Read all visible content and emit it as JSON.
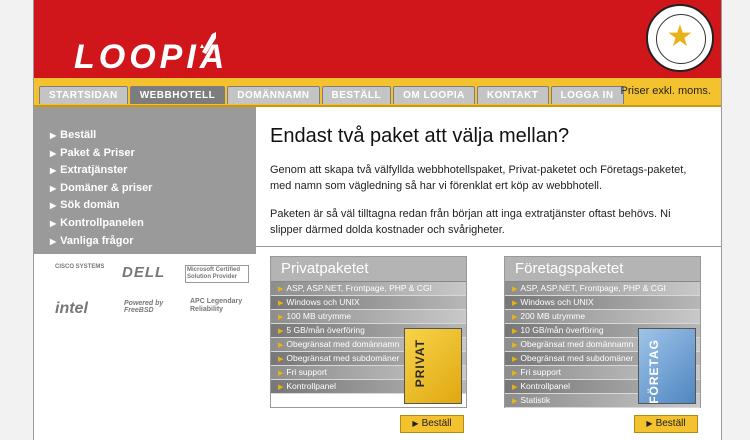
{
  "brand": {
    "logo_text": "LOOPIA",
    "seal_top": "REKOMMENDERAS AV",
    "seal_bottom": "Internetworld 2004"
  },
  "nav": {
    "tabs": [
      "STARTSIDAN",
      "WEBBHOTELL",
      "DOMÄNNAMN",
      "BESTÄLL",
      "OM LOOPIA",
      "KONTAKT",
      "LOGGA IN"
    ],
    "active_index": 1,
    "prices_note": "Priser exkl. moms."
  },
  "sidebar": {
    "items": [
      "Beställ",
      "Paket & Priser",
      "Extratjänster",
      "Domäner & priser",
      "Sök domän",
      "Kontrollpanelen",
      "Vanliga frågor"
    ]
  },
  "partners": [
    "CISCO SYSTEMS",
    "DELL",
    "Microsoft Certified Solution Provider",
    "intel",
    "Powered by FreeBSD",
    "APC Legendary Reliability"
  ],
  "main": {
    "heading": "Endast två paket att välja mellan?",
    "para1": "Genom att skapa två välfyllda webbhotellspaket, Privat-paketet och Företags-paketet, med namn som vägledning så har vi förenklat ert köp av webbhotell.",
    "para2": "Paketen är så väl tilltagna redan från början att inga extratjänster oftast behövs. Ni slipper därmed dolda kostnader och svårigheter."
  },
  "packages": [
    {
      "title": "Privatpaketet",
      "box_label": "PRIVAT",
      "features": [
        "ASP, ASP.NET, Frontpage, PHP & CGI",
        "Windows och UNIX",
        "100 MB utrymme",
        "5 GB/mån överföring",
        "Obegränsat med domännamn",
        "Obegränsat med subdomäner",
        "Fri support",
        "Kontrollpanel"
      ],
      "order_label": "Beställ"
    },
    {
      "title": "Företagspaketet",
      "box_label": "FÖRETAG",
      "features": [
        "ASP, ASP.NET, Frontpage, PHP & CGI",
        "Windows och UNIX",
        "200 MB utrymme",
        "10 GB/mån överföring",
        "Obegränsat med domännamn",
        "Obegränsat med subdomäner",
        "Fri support",
        "Kontrollpanel",
        "Statistik"
      ],
      "order_label": "Beställ"
    }
  ],
  "colors": {
    "brand_red": "#d1161b",
    "tab_yellow": "#f3c22e",
    "sidebar_gray": "#9a9a9a",
    "accent_gold": "#e8b318"
  }
}
